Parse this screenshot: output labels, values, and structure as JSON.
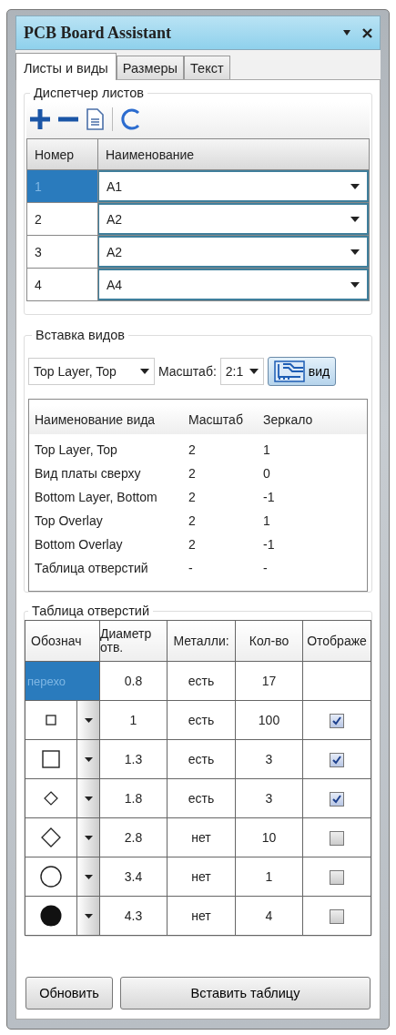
{
  "window": {
    "title": "PCB Board Assistant"
  },
  "tabs": [
    {
      "label": "Листы и виды",
      "selected": true
    },
    {
      "label": "Размеры",
      "selected": false
    },
    {
      "label": "Текст",
      "selected": false
    }
  ],
  "sheet_manager": {
    "title": "Диспетчер листов",
    "columns": [
      "Номер",
      "Наименование"
    ],
    "rows": [
      {
        "number": "1",
        "name": "A1",
        "selected": true
      },
      {
        "number": "2",
        "name": "A2",
        "selected": false
      },
      {
        "number": "3",
        "name": "A2",
        "selected": false
      },
      {
        "number": "4",
        "name": "A4",
        "selected": false
      }
    ]
  },
  "view_insert": {
    "title": "Вставка видов",
    "view_value": "Top Layer, Top",
    "scale_label": "Масштаб:",
    "scale_value": "2:1",
    "insert_button": "вид",
    "columns": [
      "Наименование вида",
      "Масштаб",
      "Зеркало"
    ],
    "rows": [
      [
        "Top Layer, Top",
        "2",
        "1"
      ],
      [
        "Вид платы сверху",
        "2",
        "0"
      ],
      [
        "Bottom Layer, Bottom",
        "2",
        "-1"
      ],
      [
        "Top Overlay",
        "2",
        "1"
      ],
      [
        "Bottom Overlay",
        "2",
        "-1"
      ],
      [
        "Таблица отверстий",
        "-",
        "-"
      ]
    ]
  },
  "hole_table": {
    "title": "Таблица отверстий",
    "columns": [
      "Обознач",
      "Диаметр отв.",
      "Металли:",
      "Кол-во",
      "Отображе"
    ],
    "rows": [
      {
        "kind": "text",
        "label": "перехо",
        "selected": true,
        "diameter": "0.8",
        "plated": "есть",
        "count": "17"
      },
      {
        "kind": "small-square",
        "selected": false,
        "diameter": "1",
        "plated": "есть",
        "count": "100",
        "checked": true
      },
      {
        "kind": "square",
        "selected": false,
        "diameter": "1.3",
        "plated": "есть",
        "count": "3",
        "checked": true
      },
      {
        "kind": "small-diamond",
        "selected": false,
        "diameter": "1.8",
        "plated": "есть",
        "count": "3",
        "checked": true
      },
      {
        "kind": "diamond",
        "selected": false,
        "diameter": "2.8",
        "plated": "нет",
        "count": "10",
        "checked": false
      },
      {
        "kind": "circle",
        "selected": false,
        "diameter": "3.4",
        "plated": "нет",
        "count": "1",
        "checked": false
      },
      {
        "kind": "filled-circle",
        "selected": false,
        "diameter": "4.3",
        "plated": "нет",
        "count": "4",
        "checked": false
      }
    ]
  },
  "buttons": [
    "Обновить",
    "Вставить таблицу"
  ]
}
